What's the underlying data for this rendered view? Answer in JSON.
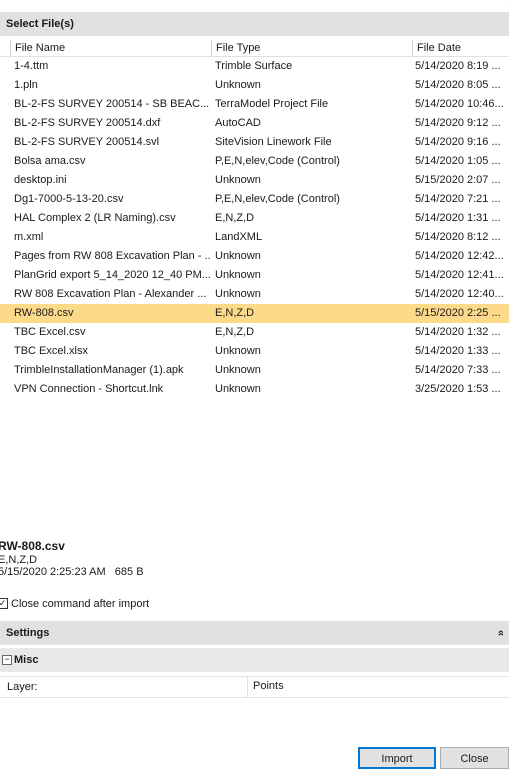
{
  "top": {
    "glyph": "’"
  },
  "select_files": {
    "title": "Select File(s)",
    "columns": [
      "File Name",
      "File Type",
      "File Date"
    ],
    "rows": [
      {
        "name": "1-4.ttm",
        "type": "Trimble Surface",
        "date": "5/14/2020 8:19 ..."
      },
      {
        "name": "1.pln",
        "type": "Unknown",
        "date": "5/14/2020 8:05 ..."
      },
      {
        "name": "BL-2-FS SURVEY 200514 - SB BEAC...",
        "type": "TerraModel Project File",
        "date": "5/14/2020 10:46..."
      },
      {
        "name": "BL-2-FS SURVEY 200514.dxf",
        "type": "AutoCAD",
        "date": "5/14/2020 9:12 ..."
      },
      {
        "name": "BL-2-FS SURVEY 200514.svl",
        "type": "SiteVision Linework File",
        "date": "5/14/2020 9:16 ..."
      },
      {
        "name": "Bolsa ama.csv",
        "type": "P,E,N,elev,Code (Control)",
        "date": "5/14/2020 1:05 ..."
      },
      {
        "name": "desktop.ini",
        "type": "Unknown",
        "date": "5/15/2020 2:07 ..."
      },
      {
        "name": "Dg1-7000-5-13-20.csv",
        "type": "P,E,N,elev,Code (Control)",
        "date": "5/14/2020 7:21 ..."
      },
      {
        "name": "HAL Complex 2 (LR Naming).csv",
        "type": "E,N,Z,D",
        "date": "5/14/2020 1:31 ..."
      },
      {
        "name": "m.xml",
        "type": "LandXML",
        "date": "5/14/2020 8:12 ..."
      },
      {
        "name": "Pages from RW 808 Excavation Plan - ...",
        "type": "Unknown",
        "date": "5/14/2020 12:42..."
      },
      {
        "name": "PlanGrid export 5_14_2020 12_40 PM....",
        "type": "Unknown",
        "date": "5/14/2020 12:41..."
      },
      {
        "name": "RW 808 Excavation Plan - Alexander ...",
        "type": "Unknown",
        "date": "5/14/2020 12:40..."
      },
      {
        "name": "RW-808.csv",
        "type": "E,N,Z,D",
        "date": "5/15/2020 2:25 ..."
      },
      {
        "name": "TBC Excel.csv",
        "type": "E,N,Z,D",
        "date": "5/14/2020 1:32 ..."
      },
      {
        "name": "TBC Excel.xlsx",
        "type": "Unknown",
        "date": "5/14/2020 1:33 ..."
      },
      {
        "name": "TrimbleInstallationManager (1).apk",
        "type": "Unknown",
        "date": "5/14/2020 7:33 ..."
      },
      {
        "name": "VPN Connection - Shortcut.lnk",
        "type": "Unknown",
        "date": "3/25/2020 1:53 ..."
      }
    ],
    "selected_index": 13,
    "selected_color": "#fdd98a"
  },
  "details": {
    "name": "RW-808.csv",
    "type": "E,N,Z,D",
    "info": "5/15/2020 2:25:23 AM   685 B"
  },
  "options": {
    "close_after_import_label": "Close command after import",
    "close_after_import_checked": "✓"
  },
  "settings": {
    "title": "Settings",
    "collapse_glyph": "»",
    "group": {
      "toggle_glyph": "−",
      "title": "Misc"
    },
    "properties": [
      {
        "label": "Layer:",
        "value": "Points"
      }
    ]
  },
  "buttons": {
    "import": "Import",
    "close": "Close"
  }
}
